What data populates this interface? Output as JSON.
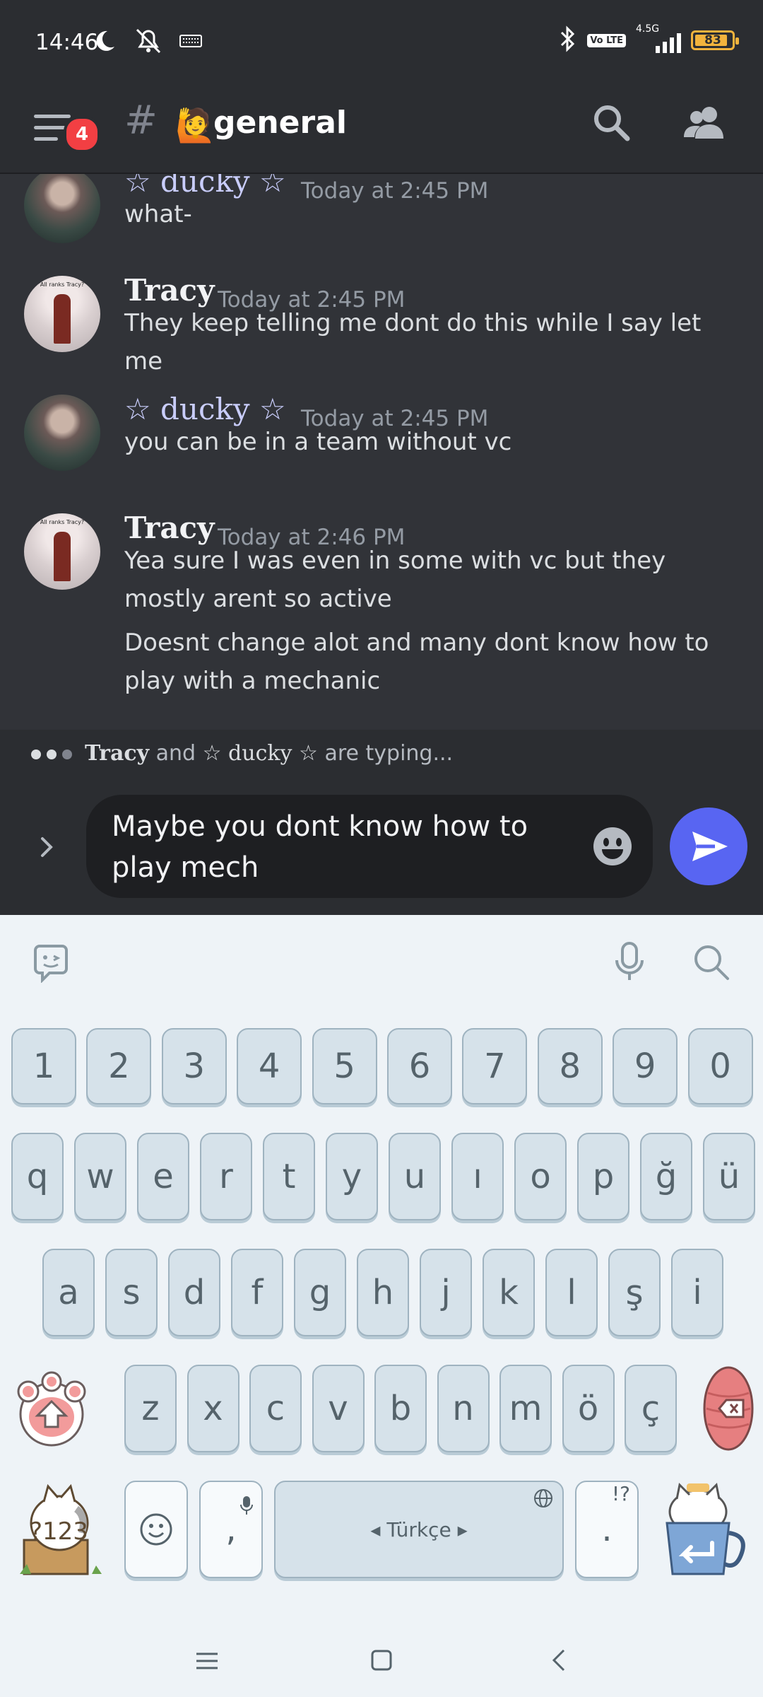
{
  "status_bar": {
    "time": "14:46",
    "network": "4.5G",
    "volte": "Vo LTE",
    "battery": "83"
  },
  "header": {
    "badge_count": "4",
    "hash_symbol": "#",
    "channel_emoji": "🙋",
    "channel_name": "general"
  },
  "messages": [
    {
      "author": "☆ ducky ☆",
      "timestamp": "Today at 2:45 PM",
      "lines": [
        "what-"
      ]
    },
    {
      "author": "Tracy",
      "timestamp": "Today at 2:45 PM",
      "lines": [
        "They keep telling me dont do this while I say let me"
      ]
    },
    {
      "author": "☆ ducky ☆",
      "timestamp": "Today at 2:45 PM",
      "lines": [
        "you can be in a team without vc"
      ]
    },
    {
      "author": "Tracy",
      "timestamp": "Today at 2:46 PM",
      "lines": [
        "Yea sure I was even in some with vc but they mostly arent so active",
        "Doesnt change alot and many dont know how to play with a mechanic"
      ]
    }
  ],
  "avatar_caption": "All ranks Tracy?",
  "typing": {
    "name1": "Tracy",
    "and": " and ",
    "name2": "☆ ducky ☆",
    "suffix": " are typing..."
  },
  "composer": {
    "text": "Maybe you dont know how to play mech"
  },
  "keyboard": {
    "number_row": [
      "1",
      "2",
      "3",
      "4",
      "5",
      "6",
      "7",
      "8",
      "9",
      "0"
    ],
    "row1": [
      "q",
      "w",
      "e",
      "r",
      "t",
      "y",
      "u",
      "ı",
      "o",
      "p",
      "ğ",
      "ü"
    ],
    "row2": [
      "a",
      "s",
      "d",
      "f",
      "g",
      "h",
      "j",
      "k",
      "l",
      "ş",
      "i"
    ],
    "row3": [
      "z",
      "x",
      "c",
      "v",
      "b",
      "n",
      "m",
      "ö",
      "ç"
    ],
    "numbers_key": "?123",
    "comma": ",",
    "space_label": "Türkçe",
    "period": ".",
    "punct_hint": "!?"
  },
  "colors": {
    "discord_bg": "#313338",
    "header_bg": "#2b2d31",
    "blurple": "#5865f2",
    "badge_red": "#f23f43",
    "key_bg": "#d6e2ea"
  }
}
